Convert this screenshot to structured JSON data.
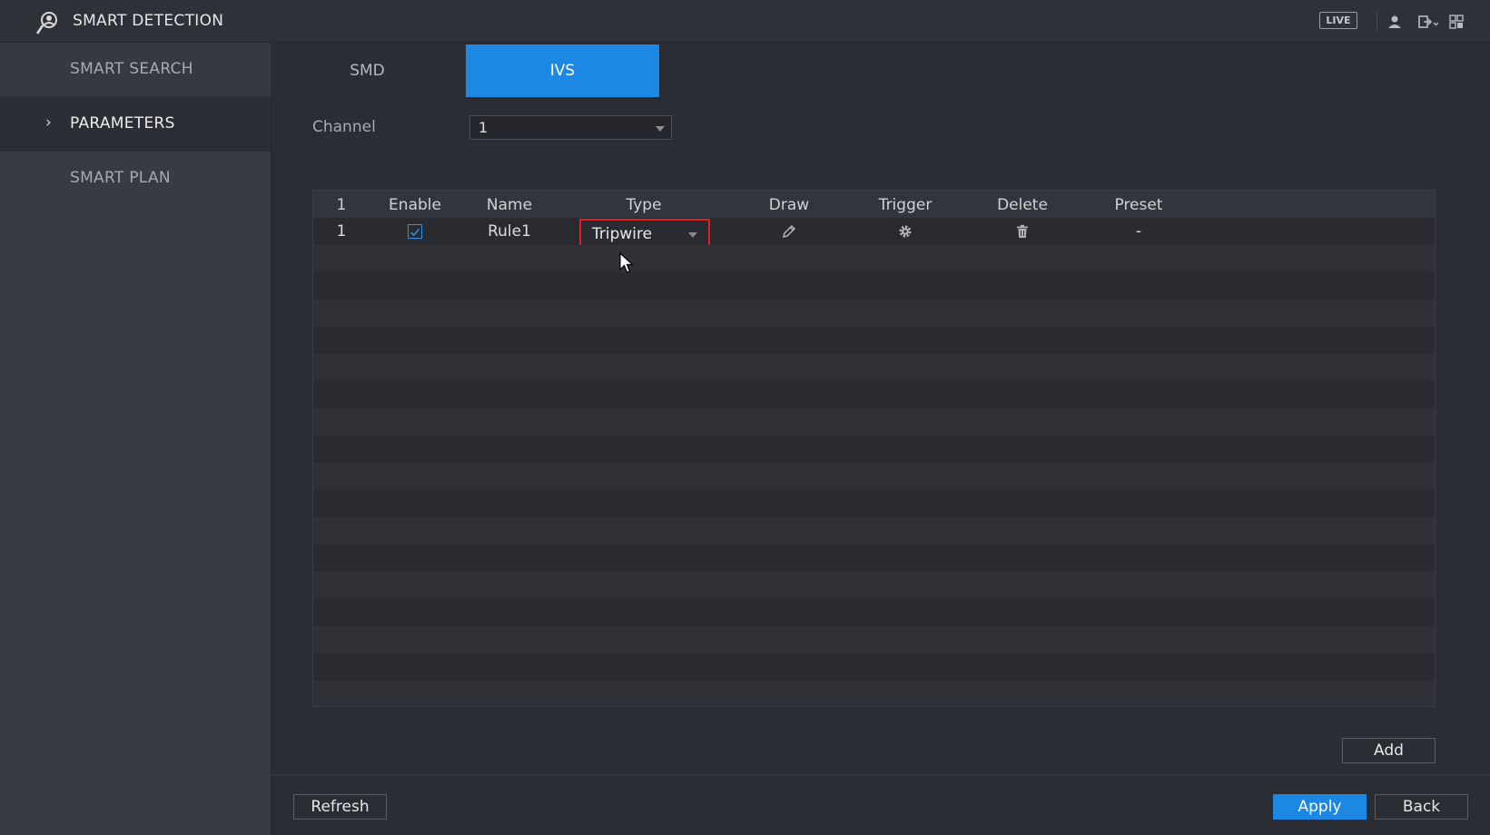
{
  "header": {
    "title": "SMART DETECTION",
    "live_label": "LIVE",
    "icons": [
      "smart-detection-icon",
      "user-icon",
      "logout-icon",
      "grid-icon"
    ]
  },
  "sidebar": {
    "items": [
      {
        "label": "SMART SEARCH",
        "active": false
      },
      {
        "label": "PARAMETERS",
        "active": true,
        "chevron": "›"
      },
      {
        "label": "SMART PLAN",
        "active": false
      }
    ]
  },
  "tabs": [
    {
      "label": "SMD",
      "active": false
    },
    {
      "label": "IVS",
      "active": true
    }
  ],
  "channel": {
    "label": "Channel",
    "value": "1"
  },
  "table": {
    "columns": [
      "1",
      "Enable",
      "Name",
      "Type",
      "Draw",
      "Trigger",
      "Delete",
      "Preset"
    ],
    "rows": [
      {
        "index": "1",
        "enabled": true,
        "name": "Rule1",
        "type": "Tripwire",
        "draw_icon": "pencil-icon",
        "trigger_icon": "gear-icon",
        "delete_icon": "trash-icon",
        "preset": "-"
      }
    ]
  },
  "buttons": {
    "add": "Add",
    "refresh": "Refresh",
    "apply": "Apply",
    "back": "Back"
  },
  "colors": {
    "accent": "#1d87e4",
    "highlight_border": "#e41d24",
    "background": "#2b2d34",
    "sidebar": "#393b43"
  }
}
